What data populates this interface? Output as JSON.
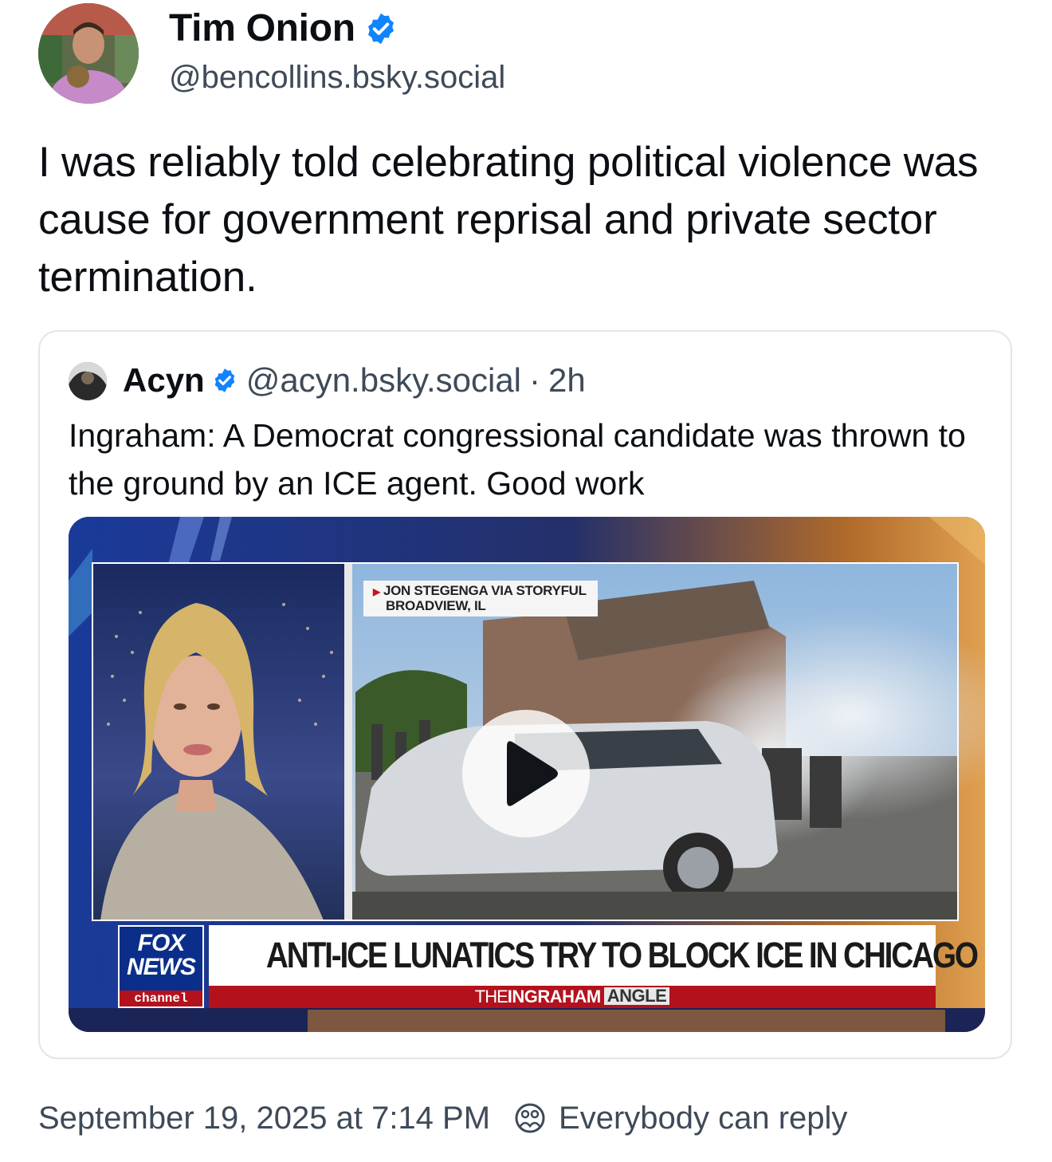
{
  "post": {
    "author": {
      "display_name": "Tim Onion",
      "handle": "@bencollins.bsky.social",
      "verified": true
    },
    "text": "I was reliably told celebrating political violence was cause for government reprisal and private sector termination.",
    "timestamp": "September 19, 2025 at 7:14 PM",
    "reply_setting": "Everybody can reply"
  },
  "quote": {
    "author": {
      "display_name": "Acyn",
      "handle": "@acyn.bsky.social",
      "verified": true
    },
    "separator": "·",
    "age": "2h",
    "text": "Ingraham: A Democrat congressional candidate was thrown to the ground by an ICE agent. Good work",
    "video": {
      "credit_line1": "JON STEGENGA VIA STORYFUL",
      "credit_line2": "BROADVIEW, IL",
      "headline": "ANTI-ICE LUNATICS TRY TO BLOCK ICE IN CHICAGO",
      "show_prefix": "THE",
      "show_name": "INGRAHAM",
      "show_suffix": "ANGLE",
      "logo_line1": "FOX",
      "logo_line2": "NEWS",
      "logo_line3": "channel"
    }
  },
  "colors": {
    "verified_blue": "#1083fe",
    "text_primary": "#0b0f14",
    "text_secondary": "#3e4a58",
    "card_border": "#e2e6ea",
    "fox_red": "#b3121d",
    "fox_blue": "#0b2e8a"
  },
  "icons": {
    "verified": "verified-badge-icon",
    "reply": "reply-settings-icon",
    "play": "play-icon"
  }
}
